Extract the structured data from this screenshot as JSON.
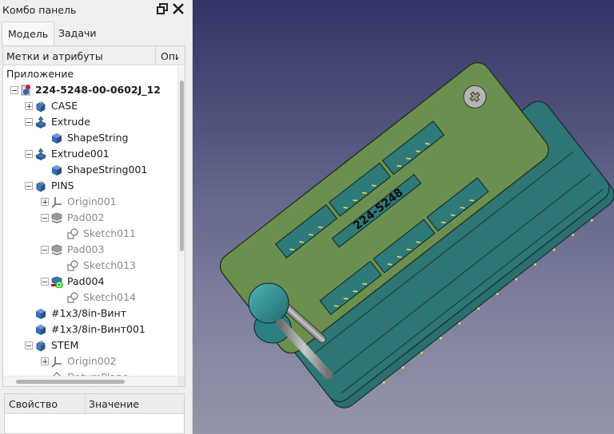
{
  "panel": {
    "title": "Комбо панель",
    "float_icon": "float-window-icon",
    "close_icon": "close-icon"
  },
  "tabs": [
    {
      "label": "Модель",
      "active": true
    },
    {
      "label": "Задачи",
      "active": false
    }
  ],
  "tree": {
    "columns": [
      "Метки и атрибуты",
      "Описание"
    ],
    "columns_visible": [
      "Метки и атрибуты",
      "Опи"
    ],
    "root_label": "Приложение",
    "items": [
      {
        "label": "224-5248-00-0602J_12",
        "icon": "document-icon",
        "expander": "minus",
        "level": 0,
        "bold": true,
        "dim": false
      },
      {
        "label": "CASE",
        "icon": "part-icon",
        "expander": "plus",
        "level": 1,
        "bold": false,
        "dim": false
      },
      {
        "label": "Extrude",
        "icon": "extrude-icon",
        "expander": "minus",
        "level": 1,
        "bold": false,
        "dim": false
      },
      {
        "label": "ShapeString",
        "icon": "shape-icon",
        "expander": "none",
        "level": 2,
        "bold": false,
        "dim": false
      },
      {
        "label": "Extrude001",
        "icon": "extrude-icon",
        "expander": "minus",
        "level": 1,
        "bold": false,
        "dim": false
      },
      {
        "label": "ShapeString001",
        "icon": "shape-icon",
        "expander": "none",
        "level": 2,
        "bold": false,
        "dim": false
      },
      {
        "label": "PINS",
        "icon": "part-icon",
        "expander": "minus",
        "level": 1,
        "bold": false,
        "dim": false
      },
      {
        "label": "Origin001",
        "icon": "origin-icon",
        "expander": "plus",
        "level": 2,
        "bold": false,
        "dim": true
      },
      {
        "label": "Pad002",
        "icon": "pad-icon",
        "expander": "minus",
        "level": 2,
        "bold": false,
        "dim": true
      },
      {
        "label": "Sketch011",
        "icon": "sketch-icon",
        "expander": "none",
        "level": 3,
        "bold": false,
        "dim": true
      },
      {
        "label": "Pad003",
        "icon": "pad-icon",
        "expander": "minus",
        "level": 2,
        "bold": false,
        "dim": true
      },
      {
        "label": "Sketch013",
        "icon": "sketch-icon",
        "expander": "none",
        "level": 3,
        "bold": false,
        "dim": true
      },
      {
        "label": "Pad004",
        "icon": "pad-tip-icon",
        "expander": "minus",
        "level": 2,
        "bold": false,
        "dim": false
      },
      {
        "label": "Sketch014",
        "icon": "sketch-icon",
        "expander": "none",
        "level": 3,
        "bold": false,
        "dim": true
      },
      {
        "label": "#1x3/8in-Винт",
        "icon": "shape-icon",
        "expander": "none",
        "level": 1,
        "bold": false,
        "dim": false
      },
      {
        "label": "#1x3/8in-Винт001",
        "icon": "shape-icon",
        "expander": "none",
        "level": 1,
        "bold": false,
        "dim": false
      },
      {
        "label": "STEM",
        "icon": "part-icon",
        "expander": "minus",
        "level": 1,
        "bold": false,
        "dim": false
      },
      {
        "label": "Origin002",
        "icon": "origin-icon",
        "expander": "plus",
        "level": 2,
        "bold": false,
        "dim": true
      },
      {
        "label": "DatumPlane",
        "icon": "datum-plane-icon",
        "expander": "none",
        "level": 2,
        "bold": false,
        "dim": true
      }
    ]
  },
  "properties": {
    "columns": [
      "Свойство",
      "Значение"
    ]
  },
  "viewport": {
    "part_label": "224-5248",
    "colors": {
      "background_top": "#333366",
      "background_bottom": "#9596a9",
      "board": "#6b8f4e",
      "body": "#2e7575",
      "pin": "#e8d84a"
    }
  }
}
